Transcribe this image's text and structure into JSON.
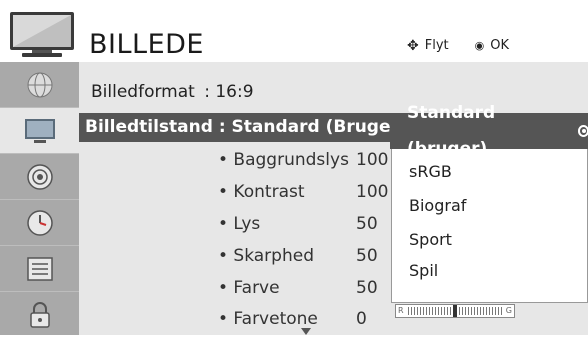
{
  "header": {
    "title": "BILLEDE",
    "move_hint": "Flyt",
    "ok_hint": "OK"
  },
  "sidebar": {
    "items": [
      {
        "icon": "globe-icon"
      },
      {
        "icon": "picture-icon",
        "active": true
      },
      {
        "icon": "audio-icon"
      },
      {
        "icon": "clock-icon"
      },
      {
        "icon": "option-icon"
      },
      {
        "icon": "lock-icon"
      }
    ]
  },
  "menu": {
    "format_label": "Billedformat",
    "format_value": ": 16:9",
    "mode_label": "Billedtilstand : Standard (Bruger)",
    "settings": [
      {
        "label": "• Baggrundslys",
        "value": "100"
      },
      {
        "label": "• Kontrast",
        "value": "100"
      },
      {
        "label": "• Lys",
        "value": "50"
      },
      {
        "label": "• Skarphed",
        "value": "50"
      },
      {
        "label": "• Farve",
        "value": "50"
      },
      {
        "label": "• Farvetone",
        "value": "0"
      }
    ]
  },
  "dropdown": {
    "selected": "Standard (bruger)",
    "options": [
      "sRGB",
      "Biograf",
      "Sport",
      "Spil"
    ]
  },
  "balance": {
    "left_label": "R",
    "right_label": "G",
    "level_fraction": 0.5
  },
  "colors": {
    "sidebar": "#a9a9a9",
    "panel": "#e7e7e7",
    "highlight": "#555555"
  }
}
